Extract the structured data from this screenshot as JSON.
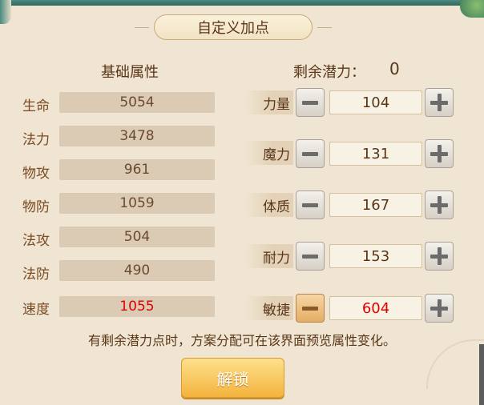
{
  "title": "自定义加点",
  "left_heading": "基础属性",
  "potential": {
    "label": "剩余潜力：",
    "value": "0"
  },
  "attributes": [
    {
      "label": "生命",
      "value": "5054"
    },
    {
      "label": "法力",
      "value": "3478"
    },
    {
      "label": "物攻",
      "value": "961"
    },
    {
      "label": "物防",
      "value": "1059"
    },
    {
      "label": "法攻",
      "value": "504"
    },
    {
      "label": "法防",
      "value": "490"
    },
    {
      "label": "速度",
      "value": "1055"
    }
  ],
  "points": [
    {
      "label": "力量",
      "value": "104"
    },
    {
      "label": "魔力",
      "value": "131"
    },
    {
      "label": "体质",
      "value": "167"
    },
    {
      "label": "耐力",
      "value": "153"
    },
    {
      "label": "敏捷",
      "value": "604"
    }
  ],
  "hint": "有剩余潜力点时，方案分配可在该界面预览属性变化。",
  "unlock_label": "解锁",
  "colors": {
    "highlight": "#e00000",
    "button": "#f4b33e",
    "panel": "#efe5d2"
  }
}
